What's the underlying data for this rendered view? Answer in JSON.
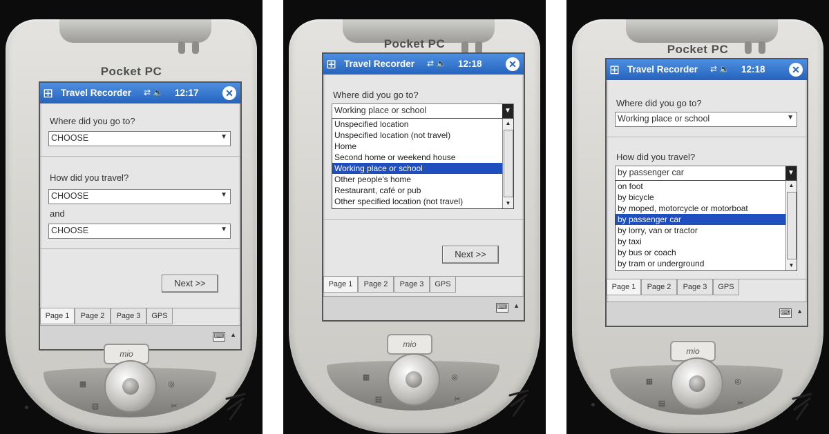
{
  "device": {
    "brand": "Pocket PC",
    "logo": "mio"
  },
  "app": {
    "title": "Travel Recorder"
  },
  "screens": [
    {
      "clock": "12:17",
      "q1": {
        "label": "Where did you go to?",
        "value": "CHOOSE"
      },
      "q2": {
        "label": "How did you travel?",
        "value1": "CHOOSE",
        "and_label": "and",
        "value2": "CHOOSE"
      },
      "next": "Next >>"
    },
    {
      "clock": "12:18",
      "q1": {
        "label": "Where did you go to?",
        "value": "Working place or school"
      },
      "dropdown": [
        "Unspecified location",
        "Unspecified location (not travel)",
        "Home",
        "Second home or weekend house",
        "Working place or school",
        "Other people's home",
        "Restaurant, café or pub",
        "Other specified location (not travel)"
      ],
      "selected_index": 4,
      "next": "Next >>"
    },
    {
      "clock": "12:18",
      "q1": {
        "label": "Where did you go to?",
        "value": "Working place or school"
      },
      "q2": {
        "label": "How did you travel?",
        "value": "by passenger car"
      },
      "dropdown": [
        "on foot",
        "by bicycle",
        "by moped, motorcycle or motorboat",
        "by passenger car",
        "by lorry, van or tractor",
        "by taxi",
        "by bus or coach",
        "by tram or underground"
      ],
      "selected_index": 3
    }
  ],
  "tabs": [
    "Page 1",
    "Page 2",
    "Page 3",
    "GPS"
  ],
  "icons": {
    "start": "windows-flag-icon",
    "connectivity": "connectivity-icon",
    "volume": "speaker-icon",
    "close": "close-icon",
    "keyboard": "keyboard-icon"
  }
}
